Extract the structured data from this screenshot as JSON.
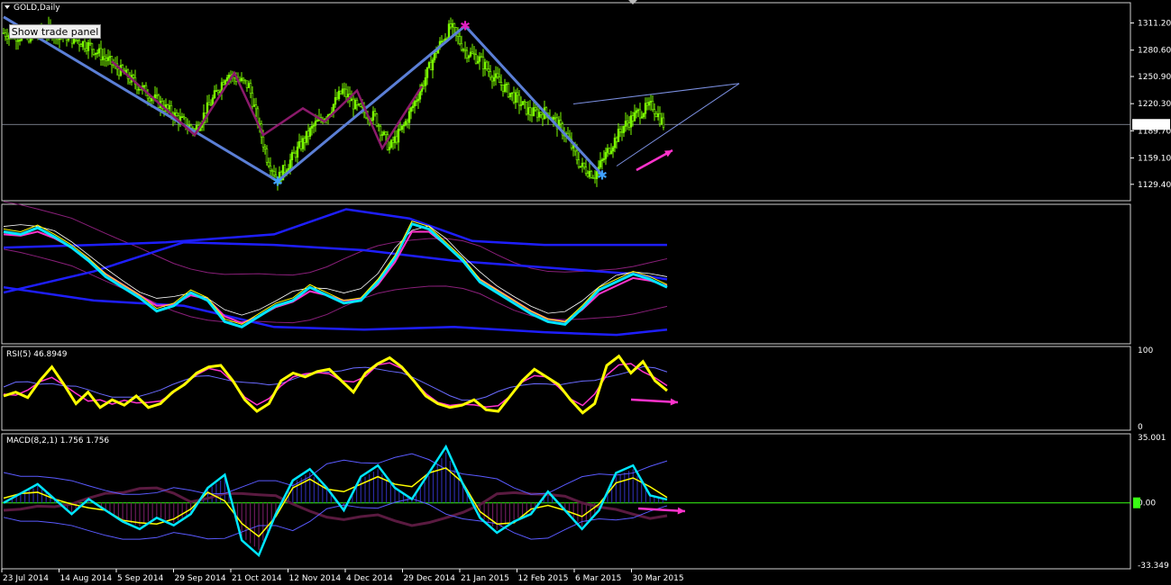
{
  "header": {
    "symbol_label": "GOLD,Daily",
    "trade_button": "Show trade panel"
  },
  "colors": {
    "bg": "#000000",
    "bull": "#7CFC00",
    "zigzag": "#5B7FD6",
    "zigzag_inner": "#8B1A6B",
    "marker": "#E020C0",
    "yellow": "#FFFF00",
    "magenta": "#FF33CC",
    "cyan": "#00E5FF",
    "white": "#FFFFFF",
    "blue": "#1E1EFF",
    "arrow": "#FF33CC",
    "hist": "#5A1A40",
    "zero_green": "#39FF14"
  },
  "chart_data": [
    {
      "type": "candlestick",
      "title": "GOLD,Daily",
      "ylim": [
        1115,
        1330
      ],
      "y_ticks": [
        "1311.20",
        "1280.60",
        "1250.90",
        "1220.30",
        "1189.70",
        "1159.10",
        "1129.40"
      ],
      "current_price": "1196.89",
      "close_path": [
        [
          0,
          1300
        ],
        [
          12,
          1295
        ],
        [
          24,
          1303
        ],
        [
          36,
          1296
        ],
        [
          48,
          1285
        ],
        [
          60,
          1265
        ],
        [
          72,
          1245
        ],
        [
          84,
          1225
        ],
        [
          96,
          1205
        ],
        [
          106,
          1190
        ],
        [
          116,
          1225
        ],
        [
          124,
          1255
        ],
        [
          136,
          1240
        ],
        [
          146,
          1160
        ],
        [
          152,
          1135
        ],
        [
          162,
          1165
        ],
        [
          172,
          1195
        ],
        [
          180,
          1210
        ],
        [
          188,
          1235
        ],
        [
          196,
          1215
        ],
        [
          206,
          1205
        ],
        [
          214,
          1170
        ],
        [
          222,
          1195
        ],
        [
          232,
          1240
        ],
        [
          240,
          1280
        ],
        [
          248,
          1307
        ],
        [
          256,
          1280
        ],
        [
          264,
          1270
        ],
        [
          272,
          1250
        ],
        [
          282,
          1230
        ],
        [
          292,
          1210
        ],
        [
          302,
          1210
        ],
        [
          312,
          1185
        ],
        [
          320,
          1150
        ],
        [
          328,
          1140
        ],
        [
          336,
          1170
        ],
        [
          344,
          1195
        ],
        [
          352,
          1210
        ],
        [
          360,
          1218
        ],
        [
          366,
          1197
        ]
      ],
      "zigzag": [
        [
          0,
          1318
        ],
        [
          152,
          1133
        ],
        [
          256,
          1308
        ],
        [
          332,
          1140
        ]
      ],
      "zigzag_inner": [
        [
          60,
          1268
        ],
        [
          106,
          1185
        ],
        [
          128,
          1255
        ],
        [
          144,
          1185
        ],
        [
          166,
          1215
        ],
        [
          178,
          1200
        ],
        [
          196,
          1235
        ],
        [
          210,
          1170
        ],
        [
          232,
          1240
        ]
      ],
      "high_marker": [
        256,
        1308
      ],
      "low_markers": [
        [
          152,
          1133
        ],
        [
          332,
          1140
        ]
      ],
      "channel_upper": [
        [
          316,
          1220
        ],
        [
          408,
          1243
        ]
      ],
      "channel_lower": [
        [
          340,
          1150
        ],
        [
          408,
          1243
        ]
      ],
      "x_range": [
        0,
        620
      ]
    },
    {
      "type": "line",
      "title": "",
      "ylim": [
        0,
        100
      ],
      "series": [
        {
          "values": [
            82,
            80,
            85,
            78,
            70,
            60,
            48,
            40,
            32,
            22,
            26,
            36,
            30,
            14,
            10,
            18,
            26,
            30,
            40,
            34,
            28,
            30,
            44,
            62,
            88,
            84,
            72,
            60,
            44,
            36,
            28,
            20,
            14,
            12,
            24,
            38,
            44,
            50,
            46,
            40
          ]
        },
        {
          "values": [
            80,
            79,
            82,
            77,
            70,
            61,
            50,
            42,
            34,
            26,
            27,
            34,
            31,
            18,
            13,
            18,
            25,
            29,
            37,
            34,
            30,
            31,
            42,
            59,
            82,
            82,
            72,
            60,
            46,
            38,
            30,
            22,
            16,
            14,
            23,
            35,
            41,
            47,
            45,
            41
          ]
        },
        {
          "values": [
            90,
            88,
            90,
            86,
            80,
            72,
            62,
            54,
            46,
            38,
            36,
            40,
            38,
            26,
            20,
            24,
            30,
            34,
            40,
            38,
            34,
            35,
            44,
            58,
            78,
            80,
            74,
            64,
            52,
            44,
            36,
            28,
            22,
            20,
            26,
            36,
            42,
            48,
            48,
            44
          ]
        }
      ]
    },
    {
      "type": "line",
      "title": "RSI(5) 46.8949",
      "ylim": [
        0,
        100
      ],
      "y_ticks": [
        "100",
        "0"
      ],
      "series": [
        {
          "name": "RSI(5)",
          "values": [
            40,
            45,
            38,
            60,
            78,
            55,
            30,
            45,
            25,
            35,
            28,
            40,
            25,
            30,
            45,
            55,
            70,
            78,
            80,
            60,
            35,
            20,
            30,
            60,
            70,
            65,
            72,
            75,
            60,
            45,
            70,
            82,
            90,
            78,
            60,
            40,
            30,
            25,
            28,
            35,
            22,
            20,
            40,
            60,
            75,
            65,
            55,
            35,
            18,
            30,
            80,
            92,
            70,
            85,
            60,
            47
          ]
        }
      ]
    },
    {
      "type": "line",
      "title": "MACD(8,2,1) 1.756 1.756",
      "ylim": [
        -33.349,
        35.001
      ],
      "y_ticks": [
        "35.001",
        "0.00",
        "-33.349"
      ],
      "series": [
        {
          "name": "MACD",
          "values": [
            0,
            5,
            10,
            2,
            -6,
            2,
            -4,
            -10,
            -14,
            -8,
            -12,
            -6,
            8,
            15,
            -20,
            -28,
            -6,
            12,
            18,
            8,
            -4,
            14,
            20,
            8,
            2,
            16,
            30,
            10,
            -8,
            -16,
            -10,
            -6,
            6,
            -4,
            -14,
            -4,
            16,
            20,
            4,
            1.756
          ]
        }
      ],
      "x_ticks": [
        "23 Jul 2014",
        "14 Aug 2014",
        "5 Sep 2014",
        "29 Sep 2014",
        "21 Oct 2014",
        "12 Nov 2014",
        "4 Dec 2014",
        "29 Dec 2014",
        "21 Jan 2015",
        "12 Feb 2015",
        "6 Mar 2015",
        "30 Mar 2015"
      ]
    }
  ]
}
